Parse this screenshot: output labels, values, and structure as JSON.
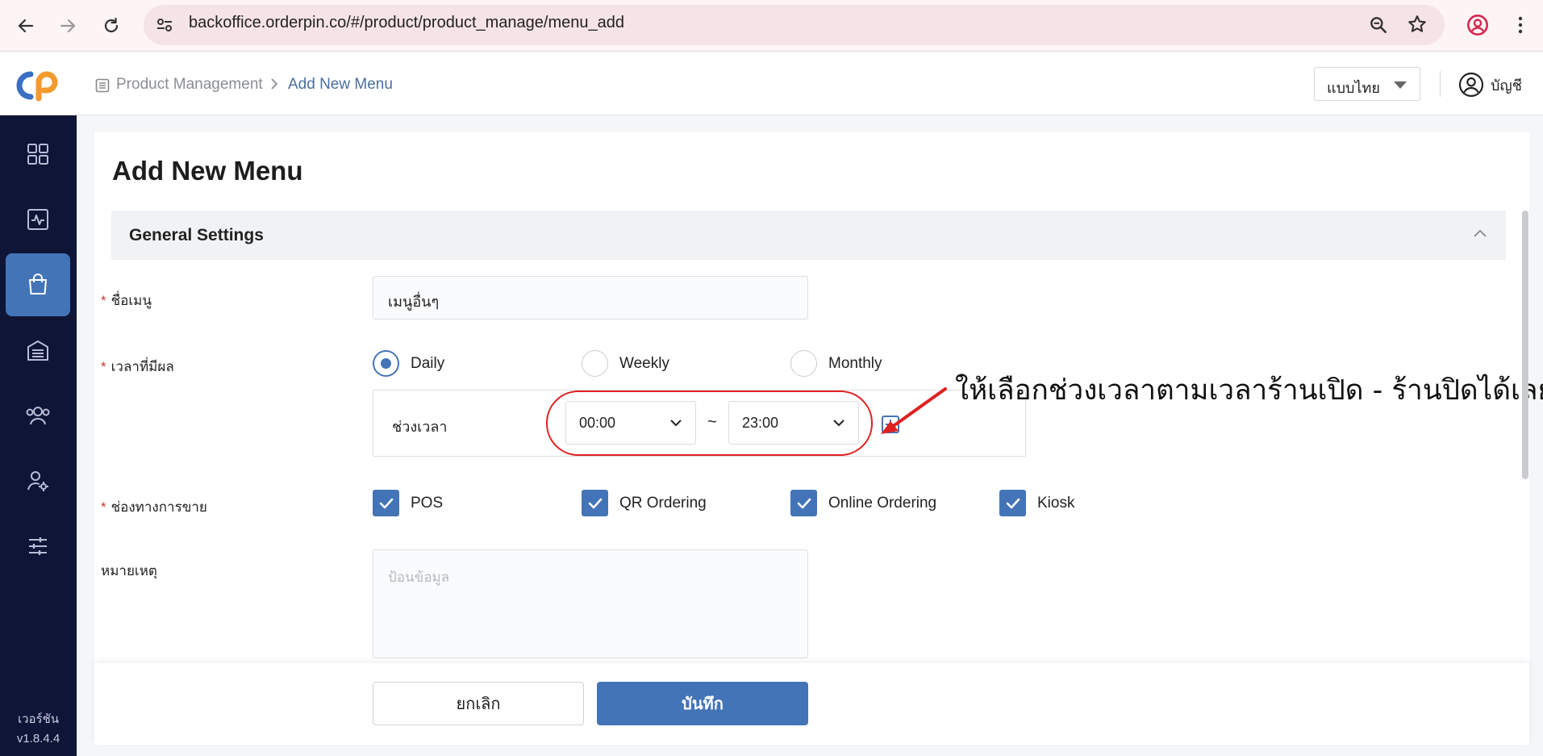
{
  "browser": {
    "url": "backoffice.orderpin.co/#/product/product_manage/menu_add"
  },
  "header": {
    "breadcrumb_parent": "Product Management",
    "breadcrumb_separator": ">",
    "breadcrumb_current": "Add New Menu",
    "language": "แบบไทย",
    "account_label": "บัญชี"
  },
  "sidebar": {
    "items": [
      {
        "icon": "dashboard-grid-icon",
        "active": false
      },
      {
        "icon": "activity-chart-icon",
        "active": false
      },
      {
        "icon": "shopping-bag-icon",
        "active": true
      },
      {
        "icon": "warehouse-icon",
        "active": false
      },
      {
        "icon": "users-group-icon",
        "active": false
      },
      {
        "icon": "user-settings-icon",
        "active": false
      },
      {
        "icon": "sliders-icon",
        "active": false
      }
    ],
    "version_label": "เวอร์ชัน",
    "version_number": "v1.8.4.4"
  },
  "page": {
    "title": "Add New Menu",
    "section_title": "General Settings"
  },
  "form": {
    "required_mark": "*",
    "menu_name_label": "ชื่อเมนู",
    "menu_name_value": "เมนูอื่นๆ",
    "effective_time_label": "เวลาที่มีผล",
    "schedule_options": [
      {
        "label": "Daily",
        "checked": true
      },
      {
        "label": "Weekly",
        "checked": false
      },
      {
        "label": "Monthly",
        "checked": false
      }
    ],
    "time_range_label": "ช่วงเวลา",
    "time_start": "00:00",
    "time_separator": "~",
    "time_end": "23:00",
    "sales_channel_label": "ช่องทางการขาย",
    "channels": [
      {
        "label": "POS",
        "checked": true
      },
      {
        "label": "QR Ordering",
        "checked": true
      },
      {
        "label": "Online Ordering",
        "checked": true
      },
      {
        "label": "Kiosk",
        "checked": true
      }
    ],
    "note_label": "หมายเหตุ",
    "note_placeholder": "ป้อนข้อมูล"
  },
  "annotation": {
    "text": "ให้เลือกช่วงเวลาตามเวลาร้านเปิด - ร้านปิดได้เลย",
    "color": "#e02020"
  },
  "footer": {
    "cancel_label": "ยกเลิก",
    "save_label": "บันทึก"
  },
  "colors": {
    "accent": "#4474b8",
    "sidebar": "#0f1537",
    "required": "#d0342c"
  }
}
